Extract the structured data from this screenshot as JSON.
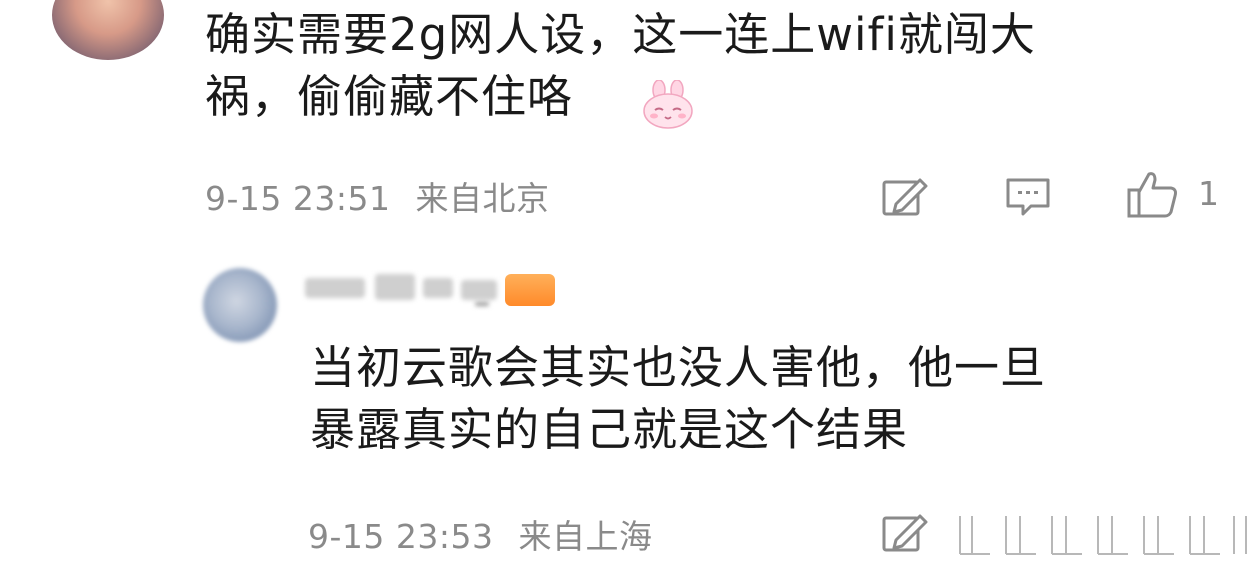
{
  "comment1": {
    "text_line1": "确实需要2g网人设，这一连上wifi就闯大",
    "text_line2": "祸，偷偷藏不住咯",
    "timestamp": "9-15 23:51",
    "location": "来自北京",
    "like_count": "1",
    "icons": [
      "edit-icon",
      "reply-icon",
      "like-icon"
    ]
  },
  "comment2": {
    "text_line1": "当初云歌会其实也没人害他，他一旦",
    "text_line2": "暴露真实的自己就是这个结果",
    "timestamp": "9-15 23:53",
    "location": "来自上海",
    "icons": [
      "edit-icon"
    ]
  },
  "colors": {
    "text": "#1a1a1a",
    "meta": "#8a8a8a",
    "badge": "#ff8a2a"
  }
}
